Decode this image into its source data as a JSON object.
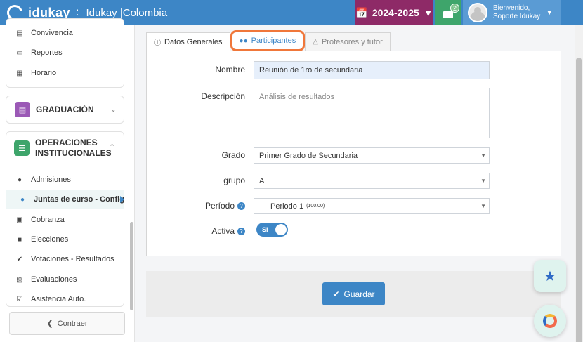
{
  "header": {
    "logo_text": "idukay",
    "institution": "Idukay |Colombia",
    "year": "2024-2025",
    "mail_count": "2",
    "user_greeting": "Bienvenido,",
    "user_name": "Soporte Idukay"
  },
  "sidebar": {
    "top_items": [
      {
        "label": "Convivencia",
        "icon": "list-icon"
      },
      {
        "label": "Reportes",
        "icon": "bar-chart-icon"
      },
      {
        "label": "Horario",
        "icon": "calendar-icon"
      }
    ],
    "graduacion": {
      "title": "GRADUACIÓN",
      "color": "#9b59b6"
    },
    "operaciones": {
      "title_line1": "OPERACIONES",
      "title_line2": "INSTITUCIONALES",
      "color": "#3ea56b"
    },
    "op_items": [
      {
        "label": "Admisiones",
        "icon": "user-plus-icon"
      },
      {
        "label": "Juntas de curso - Config",
        "icon": "users-icon",
        "active": true
      },
      {
        "label": "Cobranza",
        "icon": "money-icon"
      },
      {
        "label": "Elecciones",
        "icon": "archive-icon"
      },
      {
        "label": "Votaciones - Resultados",
        "icon": "check-circle-icon"
      },
      {
        "label": "Evaluaciones",
        "icon": "clipboard-icon"
      },
      {
        "label": "Asistencia Auto.",
        "icon": "calendar-check-icon"
      }
    ],
    "collapse_label": "Contraer"
  },
  "tabs": [
    {
      "label": "Datos Generales",
      "icon": "info-icon"
    },
    {
      "label": "Participantes",
      "icon": "users-icon"
    },
    {
      "label": "Profesores y tutor",
      "icon": "flask-icon"
    }
  ],
  "form": {
    "nombre_label": "Nombre",
    "nombre_value": "Reunión de 1ro de secundaria",
    "descripcion_label": "Descripción",
    "descripcion_placeholder": "Análisis de resultados",
    "grado_label": "Grado",
    "grado_value": "Primer Grado de Secundaria",
    "grupo_label": "grupo",
    "grupo_value": "A",
    "periodo_label": "Período",
    "periodo_value": "Periodo 1",
    "periodo_range": "(100.00)",
    "activa_label": "Activa",
    "toggle_label": "SI",
    "save_label": "Guardar"
  },
  "colors": {
    "primary": "#3d86c6",
    "year_bg": "#8e2a67",
    "mail_bg": "#3ea56b",
    "highlight": "#f0773a"
  }
}
